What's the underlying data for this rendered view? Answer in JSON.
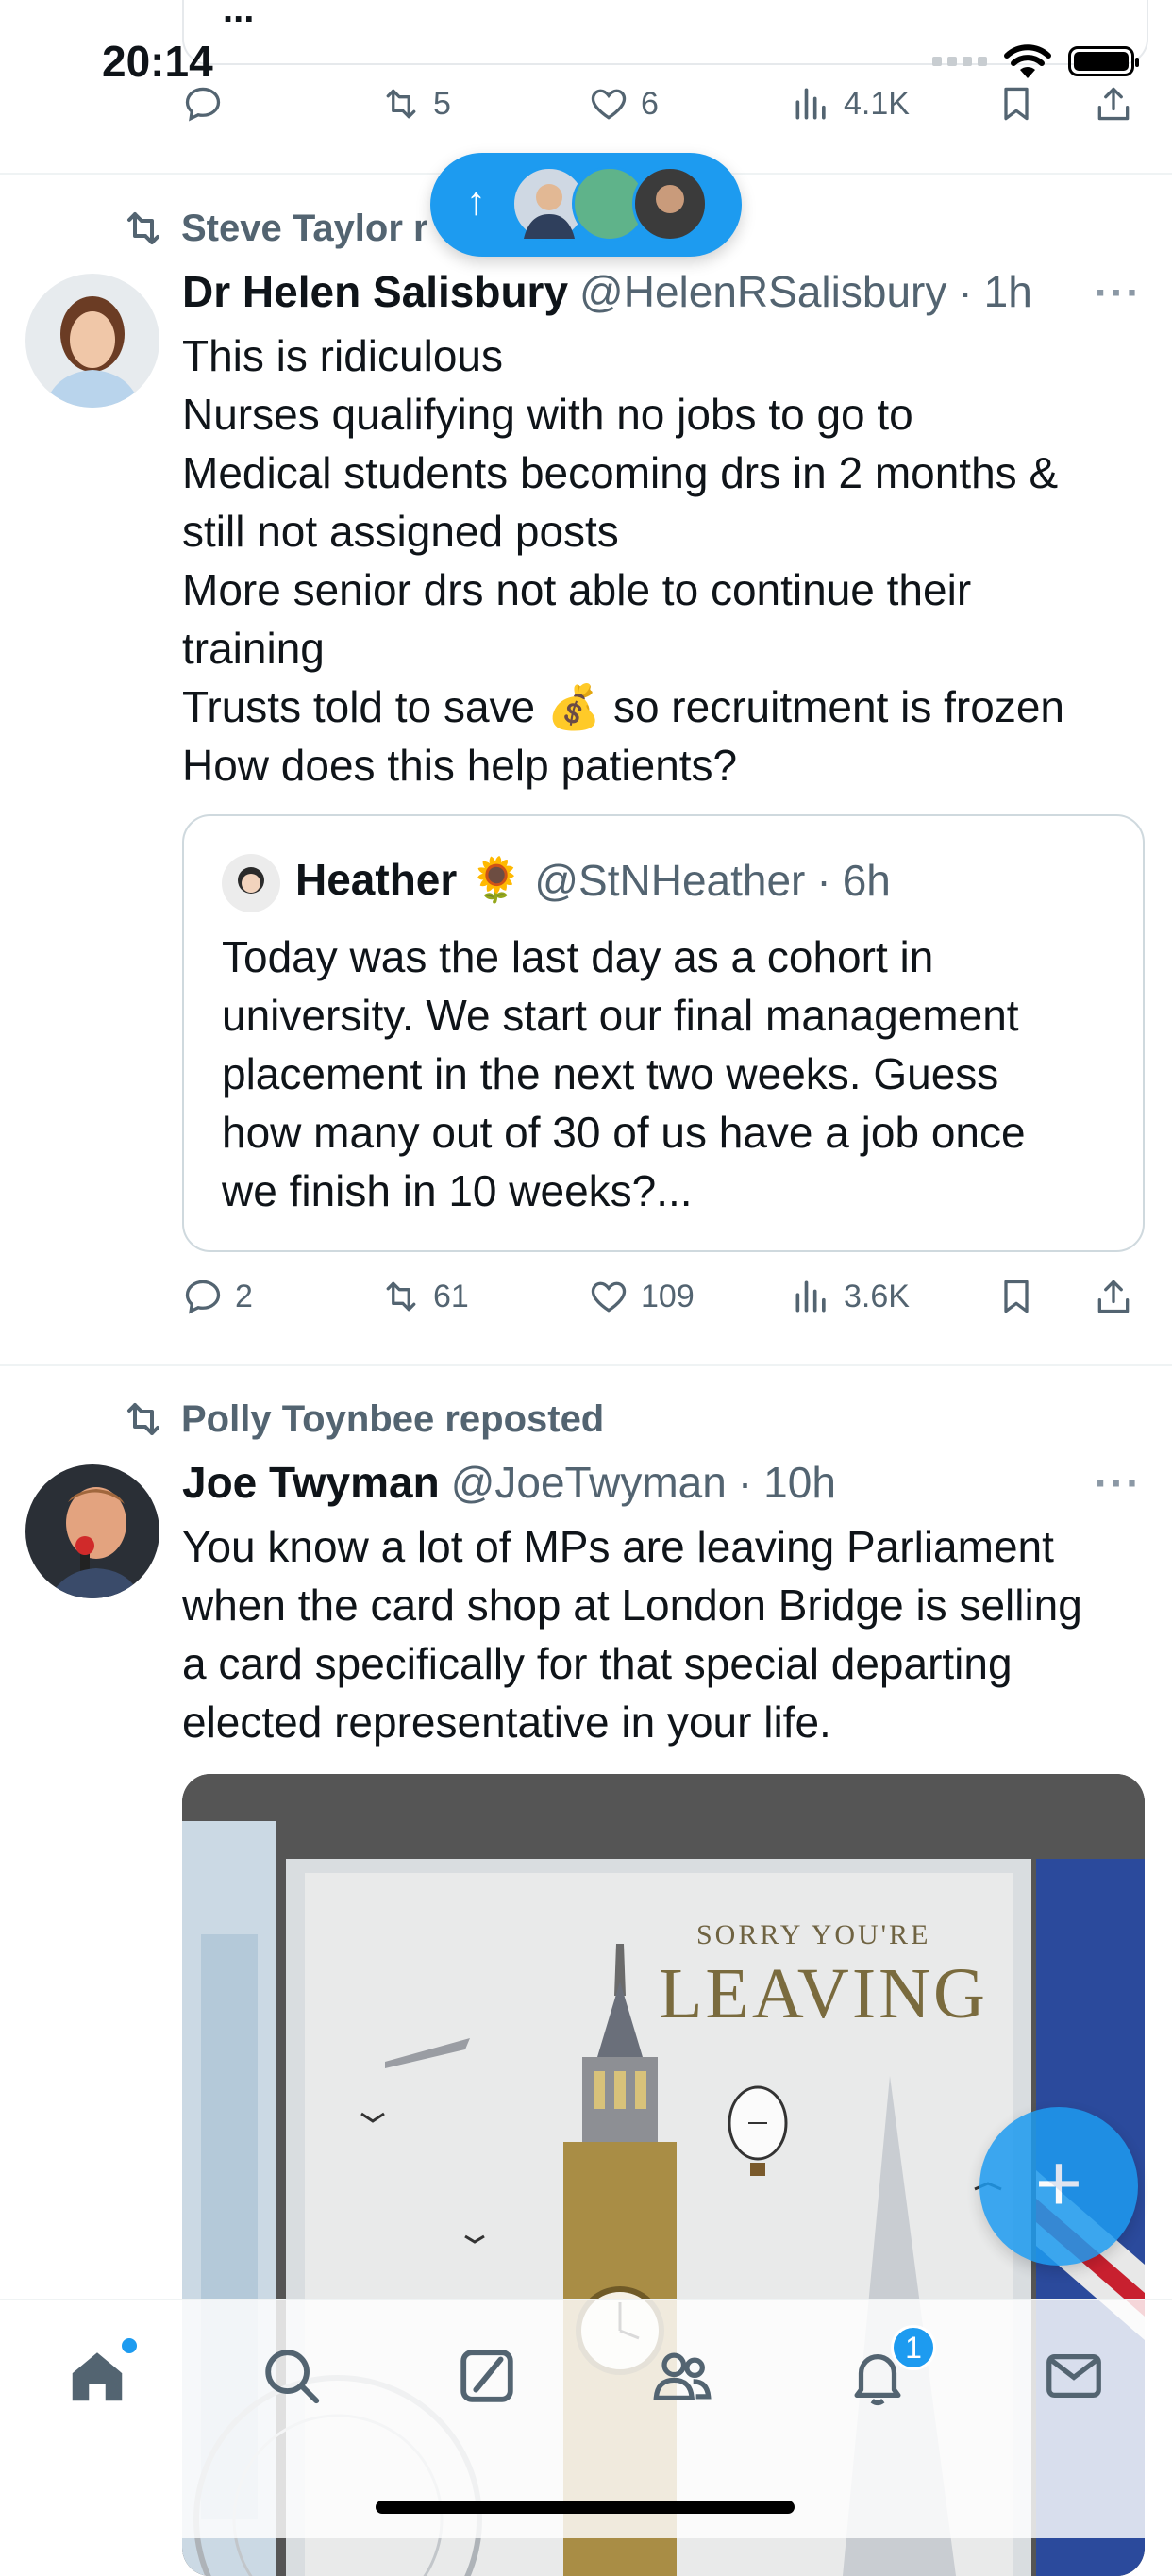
{
  "status_bar": {
    "time": "20:14"
  },
  "top_tweet": {
    "ellipsis": "...",
    "actions": {
      "replies": "",
      "reposts": "5",
      "likes": "6",
      "views": "4.1K"
    }
  },
  "new_posts_pill": {
    "arrow": "↑"
  },
  "tweet1": {
    "repost_label": "Steve Taylor r",
    "name": "Dr Helen Salisbury",
    "handle": "@HelenRSalisbury",
    "sep": "·",
    "time": "1h",
    "more": "···",
    "lines": [
      "This is ridiculous",
      "Nurses qualifying with no jobs to go to",
      "Medical students becoming drs in 2 months &",
      "still not assigned posts",
      "More senior drs not able to continue their",
      "training",
      "Trusts told to save 💰 so recruitment is frozen",
      "How does this help patients?"
    ],
    "quote": {
      "name": "Heather 🌻",
      "handle": "@StNHeather",
      "sep": "·",
      "time": "6h",
      "lines": [
        "Today was the last day as a cohort in",
        "university. We start our final management",
        "placement in the next two weeks. Guess",
        "how many out of 30 of us have a job once",
        "we finish in 10 weeks?..."
      ]
    },
    "actions": {
      "replies": "2",
      "reposts": "61",
      "likes": "109",
      "views": "3.6K"
    }
  },
  "tweet2": {
    "repost_label": "Polly Toynbee reposted",
    "name": "Joe Twyman",
    "handle": "@JoeTwyman",
    "sep": "·",
    "time": "10h",
    "more": "···",
    "lines": [
      "You know a lot of MPs are leaving Parliament",
      "when the card shop at London Bridge is selling",
      "a card specifically for that special departing",
      "elected representative in your life."
    ],
    "media": {
      "card_line1": "SORRY YOU'RE",
      "card_line2": "LEAVING"
    }
  },
  "fab": {
    "label": "+"
  },
  "tabbar": {
    "notifications_count": "1",
    "items": [
      "home-icon",
      "search-icon",
      "grok-icon",
      "communities-icon",
      "notifications-icon",
      "messages-icon"
    ]
  },
  "colors": {
    "accent": "#1d9bf0",
    "muted": "#536471",
    "text": "#0f1419"
  }
}
